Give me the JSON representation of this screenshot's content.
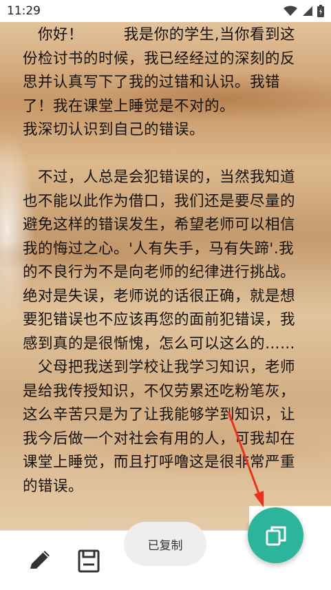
{
  "status_bar": {
    "time": "11:29"
  },
  "letter": {
    "paragraphs": [
      "   你好！        我是你的学生,当你看到这份检讨书的时候，我已经经过的深刻的反思并认真写下了我的过错和认识。我错了！我在课堂上睡觉是不对的。\n我深切认识到自己的错误。\n\n   不过，人总是会犯错误的，当然我知道也不能以此作为借口，我们还是要尽量的避免这样的错误发生，希望老师可以相信我的悔过之心。'人有失手，马有失蹄'.我的不良行为不是向老师的纪律进行挑战。绝对是失误，老师说的话很正确，就是想要犯错误也不应该再您的面前犯错误，我感到真的是很惭愧，怎么可以这么的……\n   父母把我送到学校让我学习知识，老师是给我传授知识，不仅劳累还吃粉笔灰，这么辛苦只是为了让我能够学到知识，让我今后做一个对社会有用的人，可我却在课堂上睡觉，而且打呼噜这是很非常严重的错误。"
    ]
  },
  "toast": {
    "text": "已复制"
  },
  "toolbar": {
    "edit_icon": "pencil-icon",
    "save_icon": "save-icon",
    "fab_icon": "copy-icon"
  },
  "colors": {
    "fab": "#2db59b",
    "annotation_arrow": "#e8321e"
  }
}
